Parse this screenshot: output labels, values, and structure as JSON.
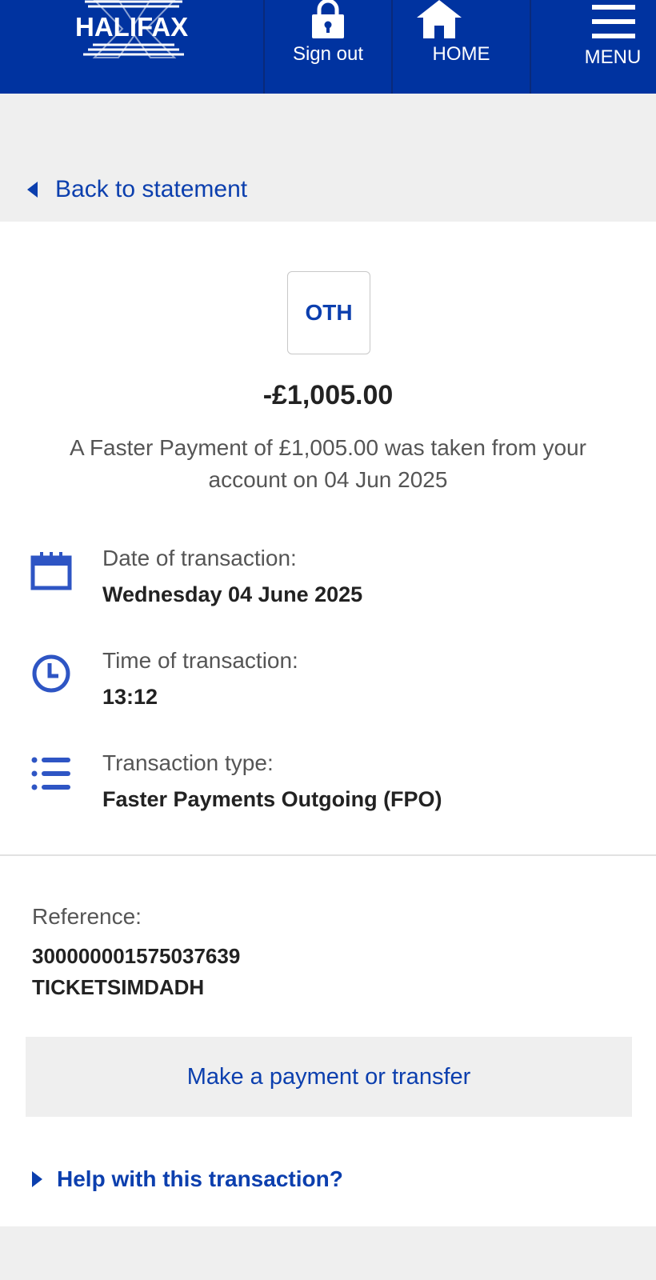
{
  "header": {
    "logo_text": "HALIFAX",
    "nav": [
      {
        "label": "Sign out",
        "icon": "lock-icon"
      },
      {
        "label": "HOME",
        "icon": "home-icon"
      },
      {
        "label": "MENU",
        "icon": "menu-icon"
      }
    ]
  },
  "back": {
    "label": "Back to statement"
  },
  "transaction": {
    "category_badge": "OTH",
    "amount": "-£1,005.00",
    "summary": "A Faster Payment of £1,005.00 was taken from your account on 04 Jun 2025",
    "details": [
      {
        "icon": "calendar-icon",
        "label": "Date of transaction:",
        "value": "Wednesday 04 June 2025"
      },
      {
        "icon": "clock-icon",
        "label": "Time of transaction:",
        "value": "13:12"
      },
      {
        "icon": "list-icon",
        "label": "Transaction type:",
        "value": "Faster Payments Outgoing (FPO)"
      }
    ],
    "reference": {
      "label": "Reference:",
      "lines": [
        "300000001575037639",
        "TICKETSIMDADH"
      ]
    }
  },
  "actions": {
    "payment_button": "Make a payment or transfer",
    "help_link": "Help with this transaction?"
  },
  "colors": {
    "brand_blue": "#0033a0",
    "link_blue": "#0c3fae"
  }
}
